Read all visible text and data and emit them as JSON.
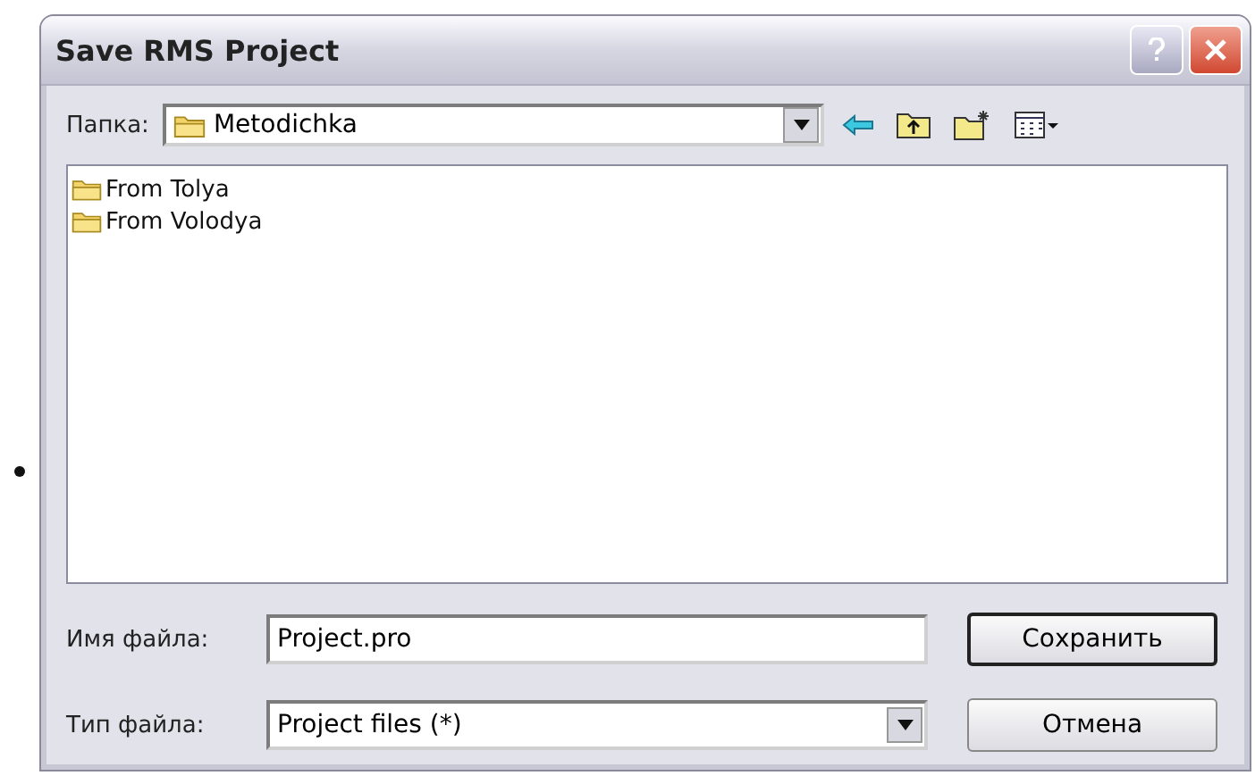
{
  "window": {
    "title": "Save RMS Project"
  },
  "location": {
    "label": "Папка:",
    "value": "Metodichka"
  },
  "files": [
    {
      "name": "From Tolya",
      "selected": false
    },
    {
      "name": "From Volodya",
      "selected": false
    }
  ],
  "filename": {
    "label": "Имя файла:",
    "value": "Project.pro"
  },
  "filetype": {
    "label": "Тип файла:",
    "value": "Project files (*)"
  },
  "buttons": [
    "Сохранить",
    "Отмена"
  ]
}
